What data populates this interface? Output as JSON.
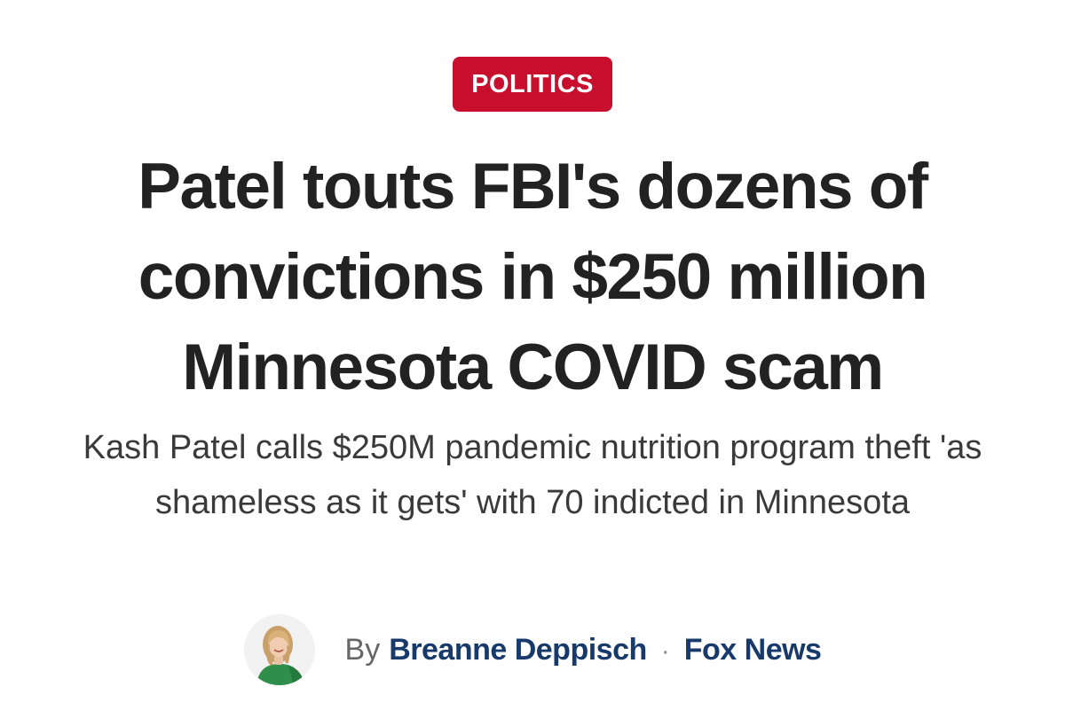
{
  "article": {
    "category": "POLITICS",
    "headline": "Patel touts FBI's dozens of convictions in $250 million Minnesota COVID scam",
    "subheadline": "Kash Patel calls $250M pandemic nutrition program theft 'as shameless as it gets' with 70 indicted in Minnesota",
    "byline": {
      "prefix": "By",
      "author": "Breanne Deppisch",
      "separator": "·",
      "outlet": "Fox News"
    }
  },
  "colors": {
    "badge_background": "#c8102e",
    "headline_text": "#222222",
    "link_text": "#173a6b"
  },
  "icons": {
    "author_avatar": "author-photo"
  }
}
